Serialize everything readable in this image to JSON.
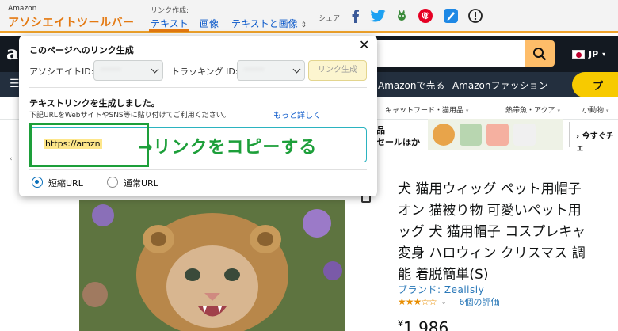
{
  "assoc_toolbar": {
    "brand_top": "Amazon",
    "brand_main": "アソシエイトツールバー",
    "link_create_label": "リンク作成:",
    "tabs": [
      {
        "label": "テキスト",
        "active": true
      },
      {
        "label": "画像",
        "active": false
      },
      {
        "label": "テキストと画像",
        "active": false
      }
    ],
    "tab_dropdown_glyph": "⇕",
    "share_label": "シェア:",
    "share_icons": [
      "facebook-icon",
      "twitter-icon",
      "hatena-icon",
      "pinterest-icon",
      "blog-icon",
      "info-icon"
    ],
    "accent_color": "#f0a32c"
  },
  "amazon_header": {
    "logo_letter": "a",
    "language": "JP"
  },
  "nav": {
    "hamburger_glyph": "☰",
    "sell": "Amazonで売る",
    "fashion": "Amazonファッション",
    "promo": "プ"
  },
  "categories": [
    "キャットフード・猫用品",
    "熱帯魚・アクア",
    "小動物"
  ],
  "promo_banner": {
    "line1": "品",
    "line2": "セールほか",
    "link": "› 今すぐチェ"
  },
  "popup": {
    "title": "このページへのリンク生成",
    "close_glyph": "✕",
    "assoc_id_label": "アソシエイトID:",
    "tracking_id_label": "トラッキング ID:",
    "link_gen_button": "リンク生成",
    "generated_msg": "テキストリンクを生成しました。",
    "instruction_msg": "下記URLをWebサイトやSNS等に貼り付けてご利用ください。",
    "learn_more": "もっと詳しく",
    "url_value": "https://amzn",
    "annotation": "→リンクをコピーする",
    "annotation_color": "#1d9f3a",
    "radio_options": [
      {
        "label": "短縮URL",
        "selected": true
      },
      {
        "label": "通常URL",
        "selected": false
      }
    ]
  },
  "product": {
    "title": "犬 猫用ウィッグ ペット用帽子\nオン 猫被り物 可愛いペット用\nッグ 犬 猫用帽子 コスプレキャ\n変身 ハロウィン クリスマス 調\n能 着脱簡単(S)",
    "brand": "ブランド: Zeaiisiy",
    "stars": "★★★☆☆",
    "rating_chevron": "⌄",
    "rating_count": "6個の評価",
    "price_symbol": "¥",
    "price": "1,986"
  }
}
